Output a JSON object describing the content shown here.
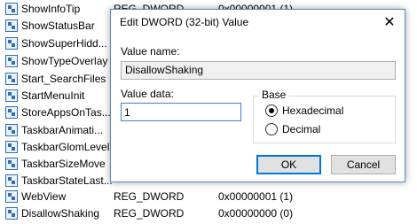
{
  "registry": {
    "rows": [
      {
        "name": "ShowInfoTip",
        "type": "REG_DWORD",
        "data": "0x00000001 (1)"
      },
      {
        "name": "ShowStatusBar",
        "type": "",
        "data": ""
      },
      {
        "name": "ShowSuperHidd...",
        "type": "",
        "data": ""
      },
      {
        "name": "ShowTypeOverlay",
        "type": "",
        "data": ""
      },
      {
        "name": "Start_SearchFiles",
        "type": "",
        "data": ""
      },
      {
        "name": "StartMenuInit",
        "type": "",
        "data": ""
      },
      {
        "name": "StoreAppsOnTas...",
        "type": "",
        "data": ""
      },
      {
        "name": "TaskbarAnimati...",
        "type": "",
        "data": ""
      },
      {
        "name": "TaskbarGlomLevel",
        "type": "",
        "data": ""
      },
      {
        "name": "TaskbarSizeMove",
        "type": "",
        "data": ""
      },
      {
        "name": "TaskbarStateLast...",
        "type": "",
        "data": ""
      },
      {
        "name": "WebView",
        "type": "REG_DWORD",
        "data": "0x00000001 (1)"
      },
      {
        "name": "DisallowShaking",
        "type": "REG_DWORD",
        "data": "0x00000000 (0)"
      }
    ]
  },
  "dialog": {
    "title": "Edit DWORD (32-bit) Value",
    "close_glyph": "✕",
    "value_name_label": "Value name:",
    "value_name": "DisallowShaking",
    "value_data_label": "Value data:",
    "value_data": "1",
    "base_label": "Base",
    "hex_label": "Hexadecimal",
    "dec_label": "Decimal",
    "selected_base": "Hexadecimal",
    "ok_label": "OK",
    "cancel_label": "Cancel"
  }
}
